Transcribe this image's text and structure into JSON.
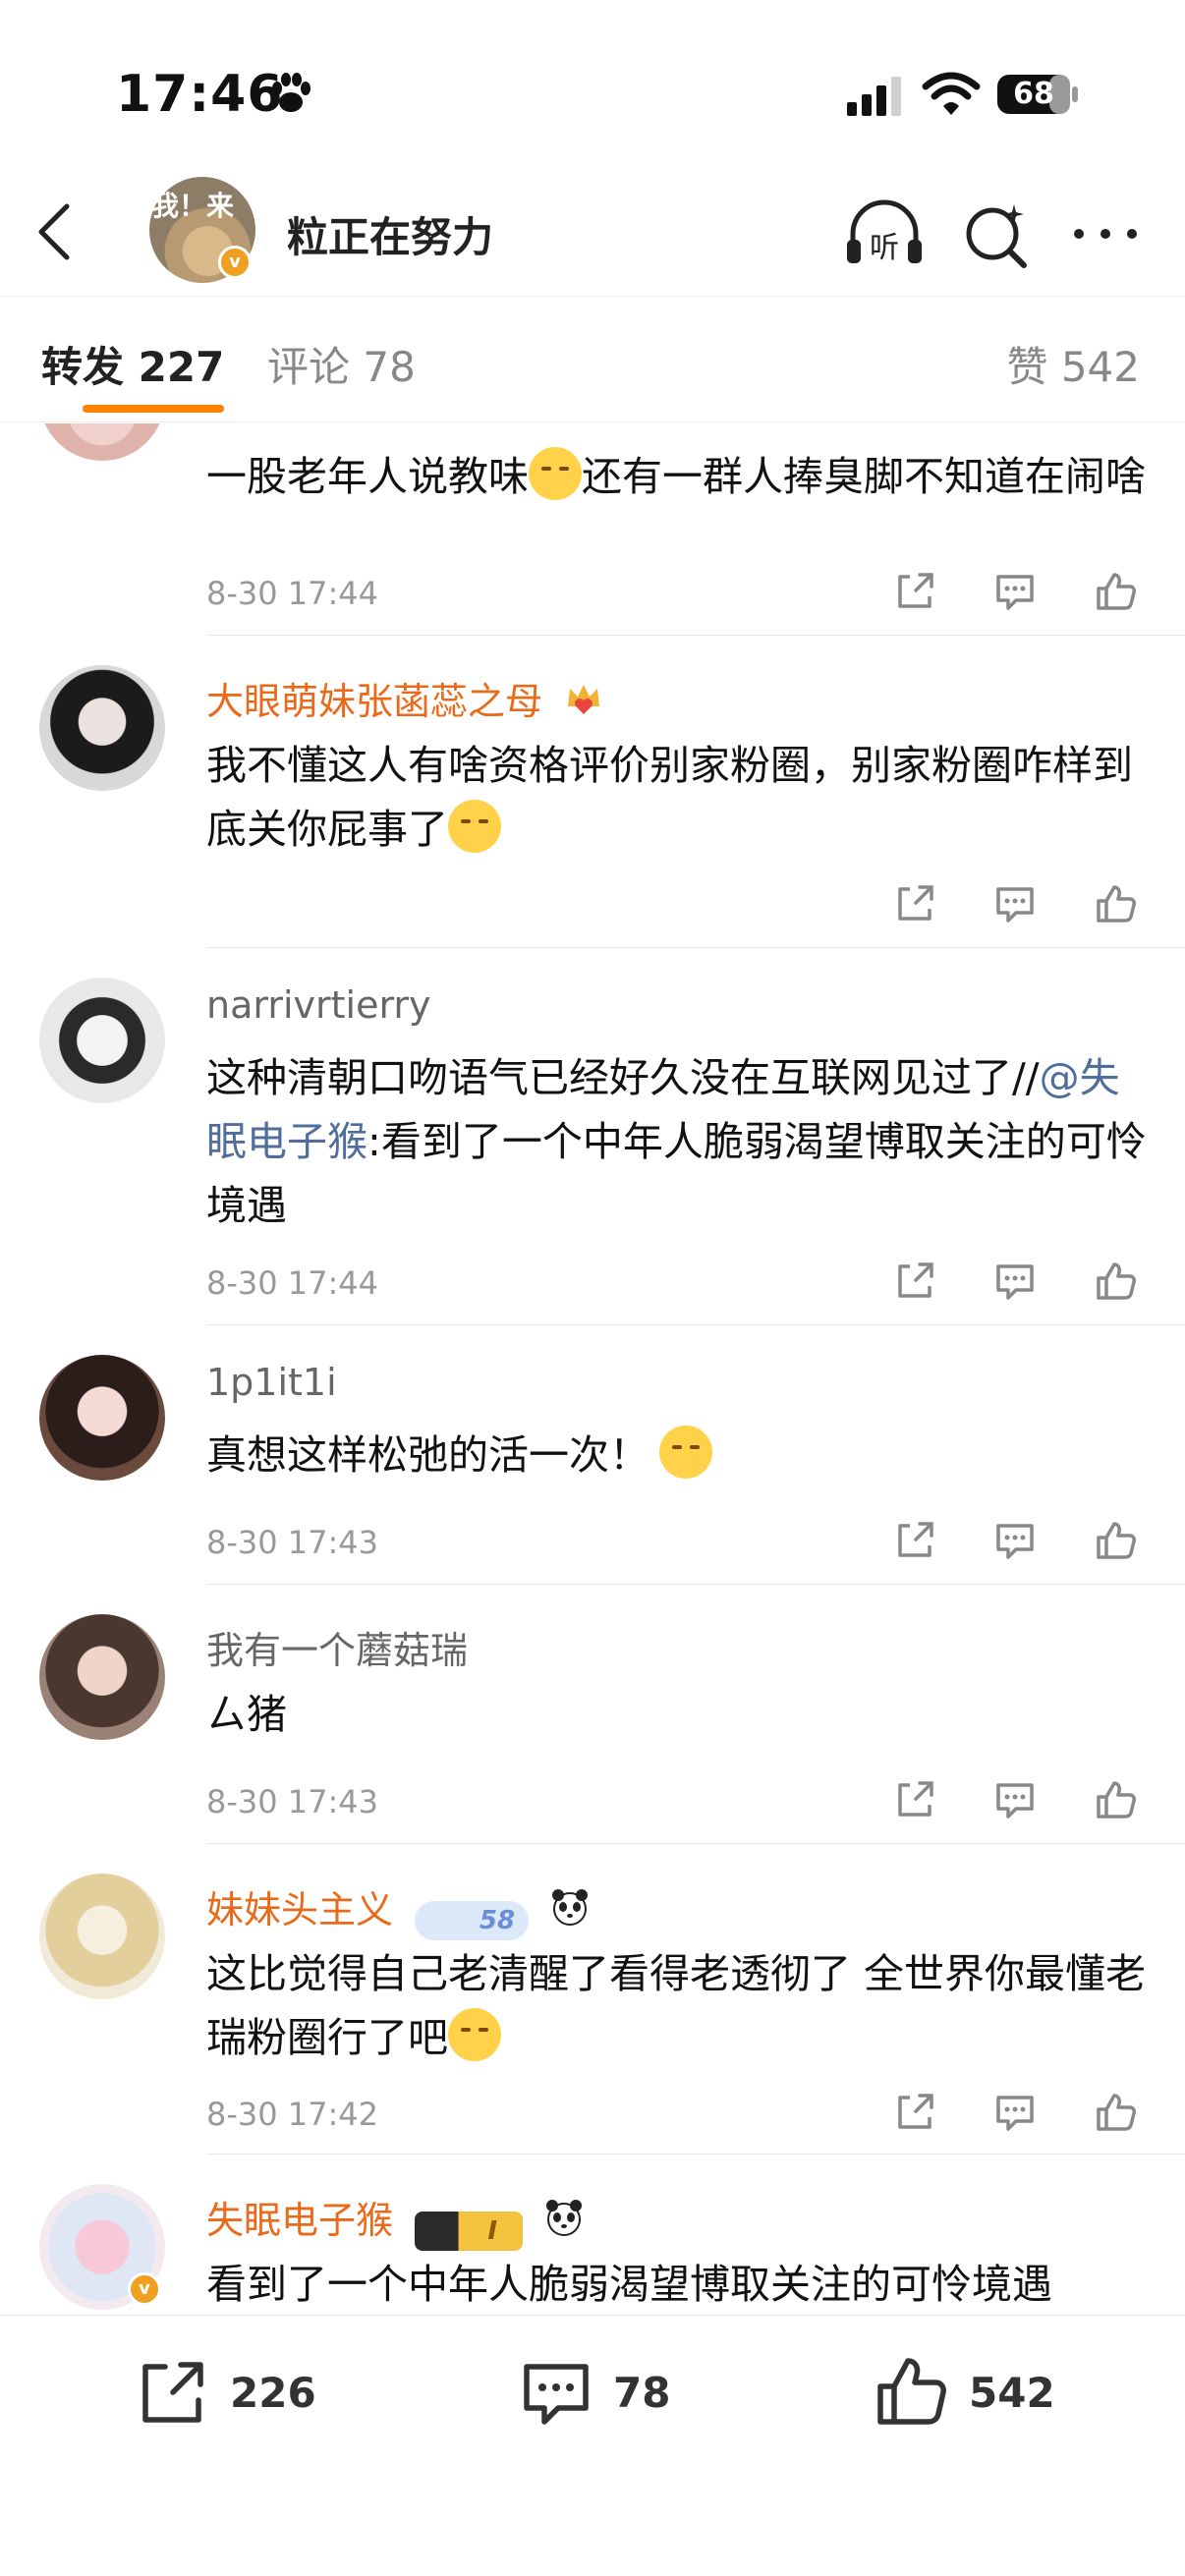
{
  "status_bar": {
    "time": "17:46",
    "battery": "68"
  },
  "header": {
    "title": "粒正在努力",
    "avatar_text": "我！来",
    "verified": "v"
  },
  "tabs": {
    "repost": "转发 227",
    "comment": "评论 78",
    "likes": "赞 542"
  },
  "comments": [
    {
      "name": "",
      "text": "一股老年人说教味",
      "text2": "还有一群人捧臭脚不知道在闹啥",
      "time": "8-30 17:44"
    },
    {
      "name": "大眼萌妹张菡蕊之母",
      "text": "我不懂这人有啥资格评价别家粉圈，别家粉圈咋样到底关你屁事了",
      "time": ""
    },
    {
      "name": "narrivrtierry",
      "text": "这种清朝口吻语气已经好久没在互联网见过了//",
      "mention": "@失眠电子猴",
      "text2": ":看到了一个中年人脆弱渴望博取关注的可怜境遇",
      "time": "8-30 17:44"
    },
    {
      "name": "1p1it1i",
      "text": "真想这样松弛的活一次！",
      "time": "8-30 17:43"
    },
    {
      "name": "我有一个蘑菇瑞",
      "text": "ㄙ猪",
      "time": "8-30 17:43"
    },
    {
      "name": "妹妹头主义",
      "tag": "58",
      "text": "这比觉得自己老清醒了看得老透彻了 全世界你最懂老瑞粉圈行了吧",
      "time": "8-30 17:42"
    },
    {
      "name": "失眠电子猴",
      "tag": "I",
      "text": "看到了一个中年人脆弱渴望博取关注的可怜境遇",
      "time": ""
    }
  ],
  "bottom_bar": {
    "repost_count": "226",
    "comment_count": "78",
    "like_count": "542"
  },
  "colors": {
    "accent": "#ff8200",
    "name_orange": "#e96a1a",
    "mention_blue": "#4f6e9e"
  },
  "icons": [
    "paw-icon",
    "signal-icon",
    "wifi-icon",
    "battery-icon",
    "back-icon",
    "listen-icon",
    "search-icon",
    "more-icon",
    "share-icon",
    "comment-icon",
    "like-icon",
    "crown-icon",
    "panda-icon",
    "verified-icon"
  ]
}
